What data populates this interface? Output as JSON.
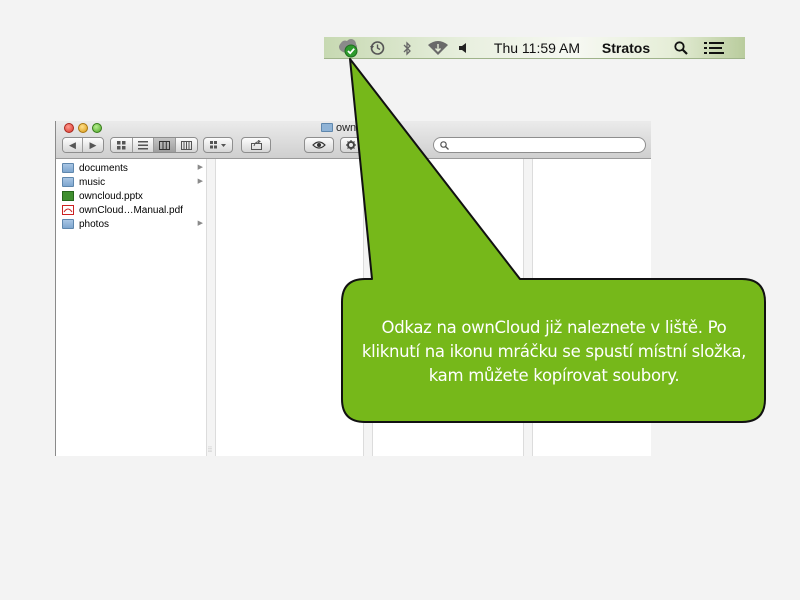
{
  "menubar": {
    "owncloud_icon": "cloud-check-icon",
    "time_machine_icon": "time-machine-icon",
    "bluetooth_icon": "bluetooth-icon",
    "wifi_icon": "wifi-icon",
    "volume_icon": "volume-icon",
    "clock": "Thu 11:59 AM",
    "user": "Stratos",
    "spotlight_icon": "magnifier-icon",
    "notifications_icon": "list-icon",
    "accent_color": "#5fa52a"
  },
  "finder": {
    "title": "ownClo",
    "search_placeholder": "",
    "files": [
      {
        "name": "documents",
        "kind": "folder",
        "has_children": true
      },
      {
        "name": "music",
        "kind": "folder",
        "has_children": true
      },
      {
        "name": "owncloud.pptx",
        "kind": "pptx",
        "has_children": false
      },
      {
        "name": "ownCloud…Manual.pdf",
        "kind": "pdf",
        "has_children": false
      },
      {
        "name": "photos",
        "kind": "folder",
        "has_children": true
      }
    ],
    "arrow_glyph": "▶",
    "back_glyph": "◀",
    "forward_glyph": "▶",
    "grid_resize_glyph": "⁞⁞"
  },
  "callout": {
    "lines": [
      "Odkaz na ownCloud již naleznete v liště. Po",
      "kliknutí na ikonu mráčku se spustí místní složka,",
      "kam můžete kopírovat soubory."
    ],
    "fill_color": "#76b81a",
    "stroke_color": "#111111"
  }
}
